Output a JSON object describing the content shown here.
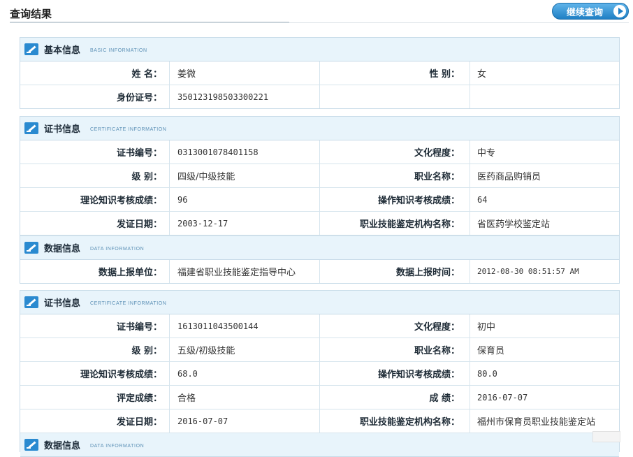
{
  "page": {
    "title": "查询结果",
    "continue_label": "继续查询"
  },
  "basic": {
    "title": "基本信息",
    "subtitle": "BASIC INFORMATION",
    "rows": [
      {
        "l1": "姓    名：",
        "v1": "姜微",
        "l2": "性    别：",
        "v2": "女"
      },
      {
        "l1": "身份证号：",
        "v1": "350123198503300221",
        "l2": "",
        "v2": ""
      }
    ]
  },
  "cert1": {
    "title": "证书信息",
    "subtitle": "CERTIFICATE INFORMATION",
    "rows": [
      {
        "l1": "证书编号：",
        "v1": "0313001078401158",
        "l2": "文化程度：",
        "v2": "中专"
      },
      {
        "l1": "级    别：",
        "v1": "四级/中级技能",
        "l2": "职业名称：",
        "v2": "医药商品购销员"
      },
      {
        "l1": "理论知识考核成绩：",
        "v1": "96",
        "l2": "操作知识考核成绩：",
        "v2": "64"
      },
      {
        "l1": "发证日期：",
        "v1": "2003-12-17",
        "l2": "职业技能鉴定机构名称：",
        "v2": "省医药学校鉴定站"
      }
    ]
  },
  "data1": {
    "title": "数据信息",
    "subtitle": "DATA INFORMATION",
    "rows": [
      {
        "l1": "数据上报单位：",
        "v1": "福建省职业技能鉴定指导中心",
        "l2": "数据上报时间：",
        "v2": "2012-08-30 08:51:57 AM"
      }
    ]
  },
  "cert2": {
    "title": "证书信息",
    "subtitle": "CERTIFICATE INFORMATION",
    "rows": [
      {
        "l1": "证书编号：",
        "v1": "1613011043500144",
        "l2": "文化程度：",
        "v2": "初中"
      },
      {
        "l1": "级    别：",
        "v1": "五级/初级技能",
        "l2": "职业名称：",
        "v2": "保育员"
      },
      {
        "l1": "理论知识考核成绩：",
        "v1": "68.0",
        "l2": "操作知识考核成绩：",
        "v2": "80.0"
      },
      {
        "l1": "评定成绩：",
        "v1": "合格",
        "l2": "成    绩：",
        "v2": "2016-07-07"
      },
      {
        "l1": "发证日期：",
        "v1": "2016-07-07",
        "l2": "职业技能鉴定机构名称：",
        "v2": "福州市保育员职业技能鉴定站"
      }
    ]
  },
  "data2": {
    "title": "数据信息",
    "subtitle": "DATA INFORMATION"
  }
}
